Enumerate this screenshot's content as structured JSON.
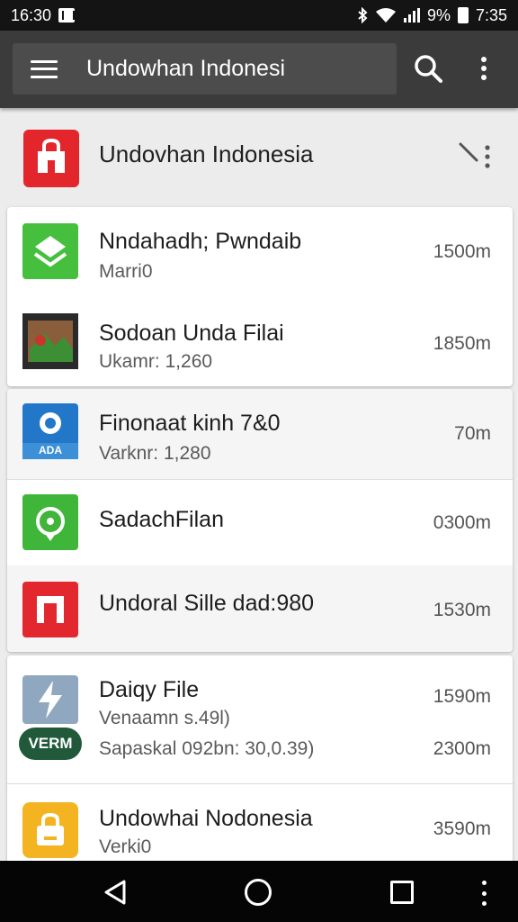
{
  "status_bar": {
    "time": "16:30",
    "battery": "9%",
    "clock_right": "7:35",
    "icons": [
      "notification-icon",
      "bluetooth-icon",
      "wifi-icon",
      "signal-icon",
      "battery-icon"
    ]
  },
  "app_bar": {
    "search_title": "Undowhan Indonesi",
    "icons": [
      "menu-icon",
      "search-icon",
      "more-vert-icon"
    ]
  },
  "header": {
    "title": "Undovhan Indonesia",
    "icon": "shopping-bag-icon",
    "icon_color": "#e3262c",
    "action_icon": "edit-more-icon"
  },
  "items": [
    {
      "title": "Nndahadh; Pwndaib",
      "sub": "Marri0",
      "size": "1500m",
      "icon": "layers-icon",
      "icon_color": "#46bf3f"
    },
    {
      "title": "Sodoan Unda Filai",
      "sub": "Ukamr: 1,260",
      "size": "1850m",
      "icon": "photo-thumbnail-icon"
    },
    {
      "title": "Finonaat kinh    7&0",
      "sub": "Varknr: 1,280",
      "size": "70m",
      "icon": "cloud-ada-icon",
      "icon_label": "ADA",
      "icon_color": "#2277c9"
    },
    {
      "title": "SadachFilan",
      "sub": "",
      "size": "0300m",
      "icon": "location-pin-icon",
      "icon_color": "#3fb63a"
    },
    {
      "title": "Undoral Sille dad:980",
      "sub": "",
      "size": "1530m",
      "icon": "red-frame-icon",
      "icon_color": "#e2282e"
    },
    {
      "title": "Daiqy File",
      "sub": "Venaamn s.49l)",
      "sub2": "Sapaskal 092bn: 30,0.39)",
      "size": "1590m",
      "size2": "2300m",
      "icon": "lightning-icon",
      "badge": "VERM",
      "icon_color": "#8fa8bf",
      "badge_color": "#215a3b"
    },
    {
      "title": "Undowhai Nodonesia",
      "sub": "Verki0",
      "size": "3590m",
      "icon": "bag-icon",
      "icon_color": "#f4b320"
    }
  ],
  "nav_bar": {
    "icons": [
      "back-icon",
      "home-icon",
      "recents-icon",
      "more-icon"
    ]
  }
}
